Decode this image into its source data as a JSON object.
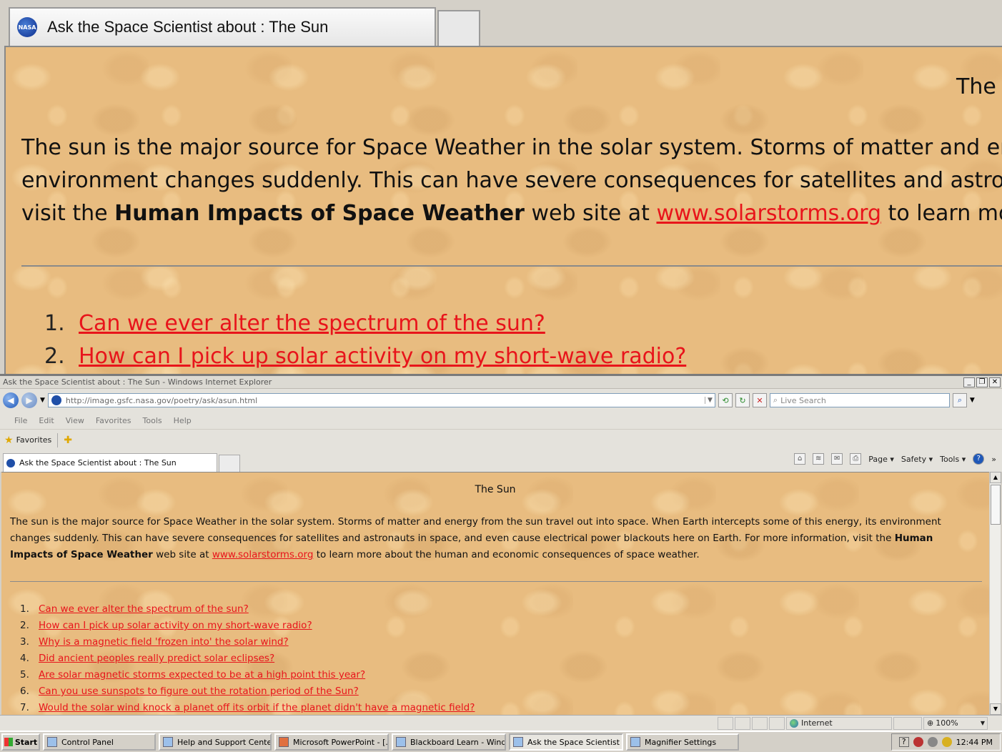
{
  "magnifier": {
    "tab_title": "Ask the Space Scientist about : The Sun",
    "nasa_icon": "NASA",
    "page_title_partial": "The :",
    "para_line1": "The sun is the major source for Space Weather in the solar system. Storms of matter and ener",
    "para_line2": "environment changes suddenly. This can have severe consequences for satellites and astronauts",
    "para_line3_pre": "visit the ",
    "para_line3_bold": "Human Impacts of Space Weather",
    "para_line3_mid": " web site at ",
    "para_line3_link": "www.solarstorms.org",
    "para_line3_post": " to learn more a",
    "items": [
      {
        "num": "1.",
        "text": "Can we ever alter the spectrum of the sun?"
      },
      {
        "num": "2.",
        "text": "How can I pick up solar activity on my short-wave radio?"
      }
    ]
  },
  "browser": {
    "window_title": "Ask the Space Scientist about : The Sun - Windows Internet Explorer",
    "url": "http://image.gsfc.nasa.gov/poetry/ask/asun.html",
    "search_placeholder": "Live Search",
    "menu": [
      "File",
      "Edit",
      "View",
      "Favorites",
      "Tools",
      "Help"
    ],
    "favorites_label": "Favorites",
    "tab_title": "Ask the Space Scientist about : The Sun",
    "commands": {
      "page": "Page",
      "safety": "Safety",
      "tools": "Tools"
    },
    "status_zone": "Internet",
    "zoom": "100%"
  },
  "content": {
    "title": "The Sun",
    "para_pre": "The sun is the major source for Space Weather in the solar system. Storms of matter and energy from the sun travel out into space. When Earth intercepts some of this energy, its environment changes suddenly. This can have severe consequences for satellites and astronauts in space, and even cause electrical power blackouts here on Earth. For more information, visit the ",
    "para_bold": "Human Impacts of Space Weather",
    "para_mid": " web site at ",
    "para_link": "www.solarstorms.org",
    "para_post": " to learn more about the human and economic consequences of space weather.",
    "questions": [
      {
        "num": "1.",
        "text": "Can we ever alter the spectrum of the sun?"
      },
      {
        "num": "2.",
        "text": "How can I pick up solar activity on my short-wave radio?"
      },
      {
        "num": "3.",
        "text": "Why is a magnetic field 'frozen into' the solar wind?"
      },
      {
        "num": "4.",
        "text": "Did ancient peoples really predict solar eclipses?"
      },
      {
        "num": "5.",
        "text": "Are solar magnetic storms expected to be at a high point this year?"
      },
      {
        "num": "6.",
        "text": "Can you use sunspots to figure out the rotation period of the Sun?"
      },
      {
        "num": "7.",
        "text": "Would the solar wind knock a planet off its orbit if the planet didn't have a magnetic field?"
      }
    ]
  },
  "taskbar": {
    "start": "Start",
    "tasks": [
      "Control Panel",
      "Help and Support Center",
      "Microsoft PowerPoint - [...",
      "Blackboard Learn - Wind...",
      "Ask the Space Scientist a...",
      "Magnifier Settings"
    ],
    "clock": "12:44 PM"
  }
}
